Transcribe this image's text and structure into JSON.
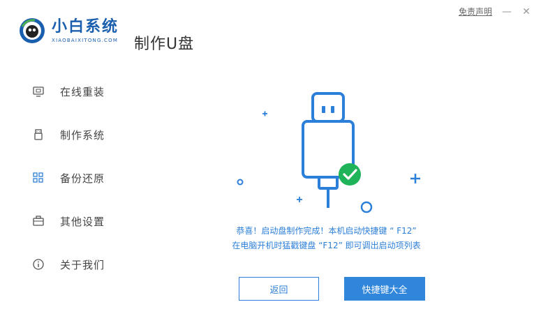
{
  "app": {
    "brand_name": "小白系统",
    "brand_sub": "XIAOBAIXITONG.COM",
    "page_title": "制作U盘",
    "disclaimer": "免责声明",
    "minimize_glyph": "—",
    "close_glyph": "✕",
    "accent_color": "#2c7fd8"
  },
  "sidebar": {
    "items": [
      {
        "label": "在线重装",
        "icon": "monitor-icon"
      },
      {
        "label": "制作系统",
        "icon": "usb-icon"
      },
      {
        "label": "备份还原",
        "icon": "grid-icon"
      },
      {
        "label": "其他设置",
        "icon": "briefcase-icon"
      },
      {
        "label": "关于我们",
        "icon": "info-icon"
      }
    ]
  },
  "main": {
    "message_line1": "恭喜！启动盘制作完成！本机启动快捷键 “ F12”",
    "message_line2": "在电脑开机时猛戳键盘 “F12” 即可调出启动项列表",
    "back_button": "返回",
    "shortcut_button": "快捷键大全",
    "success_color": "#1fb35a"
  }
}
